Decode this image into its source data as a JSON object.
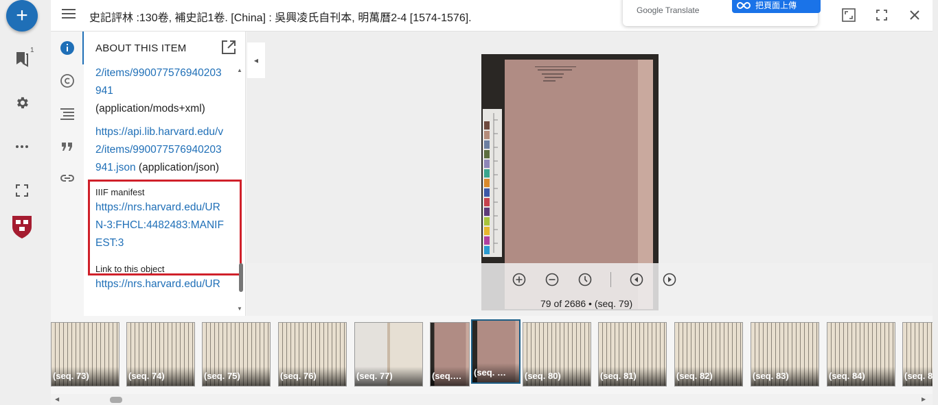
{
  "rail": {
    "add_label": "+",
    "bookmark_count": "1"
  },
  "window": {
    "title": "史記評林 :130卷, 補史記1卷. [China] : 吳興凌氏自刊本, 明萬曆2-4 [1574-1576]."
  },
  "google_translate": {
    "brand": "Google Translate",
    "button_label": "把頁面上傳"
  },
  "panel": {
    "title": "ABOUT THIS ITEM",
    "entries": [
      {
        "link": "2/items/990077576940203941",
        "format": "(application/mods+xml)"
      },
      {
        "link": "https://api.lib.harvard.edu/v2/items/990077576940203941.json",
        "format": "(application/json)"
      }
    ],
    "iiif_label": "IIIF manifest",
    "iiif_link": "https://nrs.harvard.edu/URN-3:FHCL:4482483:MANIFEST:3",
    "object_label": "Link to this object",
    "object_link": "https://nrs.harvard.edu/UR"
  },
  "viewer": {
    "seq_label": "79 of 2686 • (seq. 79)"
  },
  "thumbnails": [
    {
      "label": "(seq. 73)",
      "kind": "text"
    },
    {
      "label": "(seq. 74)",
      "kind": "text"
    },
    {
      "label": "(seq. 75)",
      "kind": "text"
    },
    {
      "label": "(seq. 76)",
      "kind": "text"
    },
    {
      "label": "(seq. 77)",
      "kind": "pale"
    },
    {
      "label": "(seq.…",
      "kind": "pink"
    },
    {
      "label": "(seq. …",
      "kind": "pink",
      "selected": true
    },
    {
      "label": "(seq. 80)",
      "kind": "text"
    },
    {
      "label": "(seq. 81)",
      "kind": "text"
    },
    {
      "label": "(seq. 82)",
      "kind": "text"
    },
    {
      "label": "(seq. 83)",
      "kind": "text"
    },
    {
      "label": "(seq. 84)",
      "kind": "text"
    },
    {
      "label": "(seq. 8",
      "kind": "text"
    }
  ],
  "colors": {
    "accent": "#1f6fb7",
    "highlight": "#d0202a",
    "page_pink": "#b08c84"
  }
}
